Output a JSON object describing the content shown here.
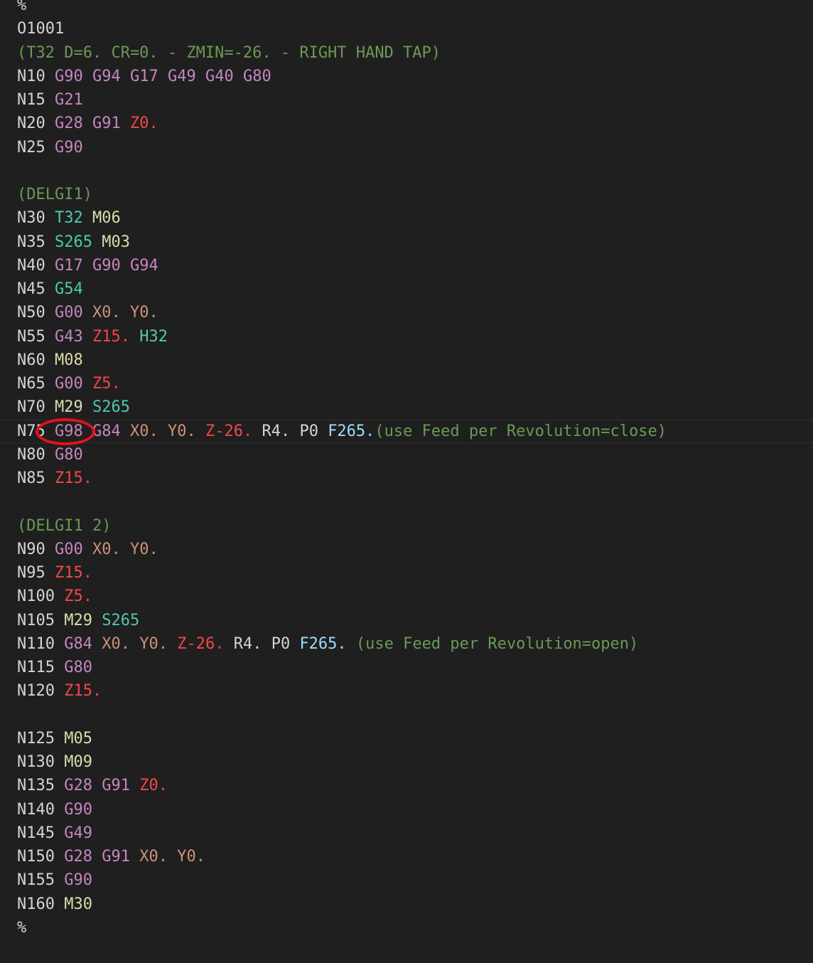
{
  "colors": {
    "background": "#1f1f1f",
    "plain": "#d4d4d4",
    "gcode": "#c586c0",
    "mcode": "#dcdcaa",
    "tool_spindle": "#4ec9b0",
    "xy": "#ce9178",
    "z": "#f44747",
    "feed": "#9cdcfe",
    "comment": "#6a9955",
    "annotation": "#e8101c"
  },
  "annotation": {
    "shape": "hand-drawn red circle",
    "target": "G98"
  },
  "lines": [
    [
      [
        "plain",
        "%"
      ]
    ],
    [
      [
        "plain",
        "O1001"
      ]
    ],
    [
      [
        "comment",
        "(T32 D=6. CR=0. - ZMIN=-26. - RIGHT HAND TAP)"
      ]
    ],
    [
      [
        "plain",
        "N10 "
      ],
      [
        "gcode",
        "G90"
      ],
      [
        "plain",
        " "
      ],
      [
        "gcode",
        "G94"
      ],
      [
        "plain",
        " "
      ],
      [
        "gcode",
        "G17"
      ],
      [
        "plain",
        " "
      ],
      [
        "gcode",
        "G49"
      ],
      [
        "plain",
        " "
      ],
      [
        "gcode",
        "G40"
      ],
      [
        "plain",
        " "
      ],
      [
        "gcode",
        "G80"
      ]
    ],
    [
      [
        "plain",
        "N15 "
      ],
      [
        "gcode",
        "G21"
      ]
    ],
    [
      [
        "plain",
        "N20 "
      ],
      [
        "gcode",
        "G28"
      ],
      [
        "plain",
        " "
      ],
      [
        "gcode",
        "G91"
      ],
      [
        "plain",
        " "
      ],
      [
        "z",
        "Z0."
      ]
    ],
    [
      [
        "plain",
        "N25 "
      ],
      [
        "gcode",
        "G90"
      ]
    ],
    [],
    [
      [
        "comment",
        "(DELGI1)"
      ]
    ],
    [
      [
        "plain",
        "N30 "
      ],
      [
        "ts",
        "T32"
      ],
      [
        "plain",
        " "
      ],
      [
        "mcode",
        "M06"
      ]
    ],
    [
      [
        "plain",
        "N35 "
      ],
      [
        "ts",
        "S265"
      ],
      [
        "plain",
        " "
      ],
      [
        "mcode",
        "M03"
      ]
    ],
    [
      [
        "plain",
        "N40 "
      ],
      [
        "gcode",
        "G17"
      ],
      [
        "plain",
        " "
      ],
      [
        "gcode",
        "G90"
      ],
      [
        "plain",
        " "
      ],
      [
        "gcode",
        "G94"
      ]
    ],
    [
      [
        "plain",
        "N45 "
      ],
      [
        "ts",
        "G54"
      ]
    ],
    [
      [
        "plain",
        "N50 "
      ],
      [
        "gcode",
        "G00"
      ],
      [
        "plain",
        " "
      ],
      [
        "xy",
        "X0."
      ],
      [
        "plain",
        " "
      ],
      [
        "xy",
        "Y0."
      ]
    ],
    [
      [
        "plain",
        "N55 "
      ],
      [
        "gcode",
        "G43"
      ],
      [
        "plain",
        " "
      ],
      [
        "z",
        "Z15."
      ],
      [
        "plain",
        " "
      ],
      [
        "ts",
        "H32"
      ]
    ],
    [
      [
        "plain",
        "N60 "
      ],
      [
        "mcode",
        "M08"
      ]
    ],
    [
      [
        "plain",
        "N65 "
      ],
      [
        "gcode",
        "G00"
      ],
      [
        "plain",
        " "
      ],
      [
        "z",
        "Z5."
      ]
    ],
    [
      [
        "plain",
        "N70 "
      ],
      [
        "mcode",
        "M29"
      ],
      [
        "plain",
        " "
      ],
      [
        "ts",
        "S265"
      ]
    ],
    [
      [
        "plain",
        "N75 "
      ],
      [
        "gcode",
        "G98"
      ],
      [
        "plain",
        " "
      ],
      [
        "gcode",
        "G84"
      ],
      [
        "plain",
        " "
      ],
      [
        "xy",
        "X0."
      ],
      [
        "plain",
        " "
      ],
      [
        "xy",
        "Y0."
      ],
      [
        "plain",
        " "
      ],
      [
        "z",
        "Z-26."
      ],
      [
        "plain",
        " R4. P0 "
      ],
      [
        "feed",
        "F265."
      ],
      [
        "comment",
        "(use Feed per Revolution=close)"
      ]
    ],
    [
      [
        "plain",
        "N80 "
      ],
      [
        "gcode",
        "G80"
      ]
    ],
    [
      [
        "plain",
        "N85 "
      ],
      [
        "z",
        "Z15."
      ]
    ],
    [],
    [
      [
        "comment",
        "(DELGI1 2)"
      ]
    ],
    [
      [
        "plain",
        "N90 "
      ],
      [
        "gcode",
        "G00"
      ],
      [
        "plain",
        " "
      ],
      [
        "xy",
        "X0."
      ],
      [
        "plain",
        " "
      ],
      [
        "xy",
        "Y0."
      ]
    ],
    [
      [
        "plain",
        "N95 "
      ],
      [
        "z",
        "Z15."
      ]
    ],
    [
      [
        "plain",
        "N100 "
      ],
      [
        "z",
        "Z5."
      ]
    ],
    [
      [
        "plain",
        "N105 "
      ],
      [
        "mcode",
        "M29"
      ],
      [
        "plain",
        " "
      ],
      [
        "ts",
        "S265"
      ]
    ],
    [
      [
        "plain",
        "N110 "
      ],
      [
        "gcode",
        "G84"
      ],
      [
        "plain",
        " "
      ],
      [
        "xy",
        "X0."
      ],
      [
        "plain",
        " "
      ],
      [
        "xy",
        "Y0."
      ],
      [
        "plain",
        " "
      ],
      [
        "z",
        "Z-26."
      ],
      [
        "plain",
        " R4. P0 "
      ],
      [
        "feed",
        "F265."
      ],
      [
        "plain",
        " "
      ],
      [
        "comment",
        "(use Feed per Revolution=open)"
      ]
    ],
    [
      [
        "plain",
        "N115 "
      ],
      [
        "gcode",
        "G80"
      ]
    ],
    [
      [
        "plain",
        "N120 "
      ],
      [
        "z",
        "Z15."
      ]
    ],
    [],
    [
      [
        "plain",
        "N125 "
      ],
      [
        "mcode",
        "M05"
      ]
    ],
    [
      [
        "plain",
        "N130 "
      ],
      [
        "mcode",
        "M09"
      ]
    ],
    [
      [
        "plain",
        "N135 "
      ],
      [
        "gcode",
        "G28"
      ],
      [
        "plain",
        " "
      ],
      [
        "gcode",
        "G91"
      ],
      [
        "plain",
        " "
      ],
      [
        "z",
        "Z0."
      ]
    ],
    [
      [
        "plain",
        "N140 "
      ],
      [
        "gcode",
        "G90"
      ]
    ],
    [
      [
        "plain",
        "N145 "
      ],
      [
        "gcode",
        "G49"
      ]
    ],
    [
      [
        "plain",
        "N150 "
      ],
      [
        "gcode",
        "G28"
      ],
      [
        "plain",
        " "
      ],
      [
        "gcode",
        "G91"
      ],
      [
        "plain",
        " "
      ],
      [
        "xy",
        "X0."
      ],
      [
        "plain",
        " "
      ],
      [
        "xy",
        "Y0."
      ]
    ],
    [
      [
        "plain",
        "N155 "
      ],
      [
        "gcode",
        "G90"
      ]
    ],
    [
      [
        "plain",
        "N160 "
      ],
      [
        "mcode",
        "M30"
      ]
    ],
    [
      [
        "plain",
        "%"
      ]
    ]
  ]
}
